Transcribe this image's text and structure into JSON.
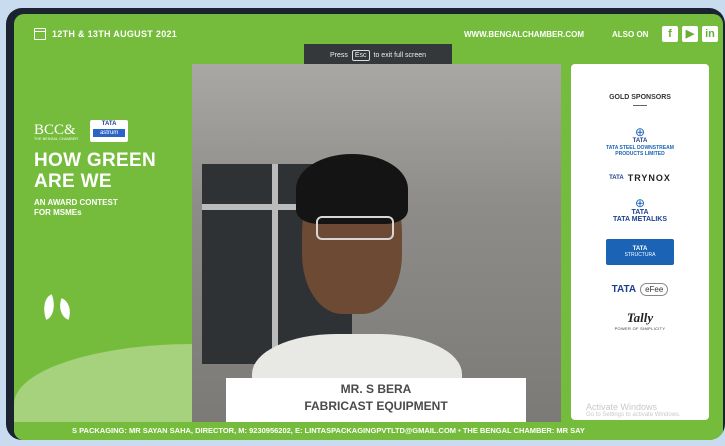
{
  "header": {
    "date": "12TH & 13TH AUGUST 2021",
    "website": "WWW.BENGALCHAMBER.COM",
    "also_on": "ALSO ON",
    "social": [
      "f",
      "▶",
      "in"
    ]
  },
  "fullscreen_hint": {
    "prefix": "Press",
    "key": "Esc",
    "suffix": "to exit full screen"
  },
  "event": {
    "logo_bcc": "BCC&",
    "logo_bcc_sub": "THE BENGAL CHAMBER",
    "logo_tata": "TATA",
    "logo_astrum": "astrum",
    "title_line1": "HOW GREEN",
    "title_line2": "ARE WE",
    "subtitle_line1": "AN AWARD CONTEST",
    "subtitle_line2": "FOR MSMEs"
  },
  "speaker": {
    "name": "MR. S BERA",
    "company": "FABRICAST EQUIPMENT"
  },
  "sponsors": {
    "heading": "GOLD SPONSORS",
    "items": [
      {
        "mark": "TATA",
        "label": "TATA STEEL DOWNSTREAM PRODUCTS LIMITED"
      },
      {
        "mark": "TATA",
        "label": "TRYNOX"
      },
      {
        "mark": "TATA",
        "label": "TATA METALIKS"
      },
      {
        "mark": "TATA",
        "label": "STRUCTURA"
      },
      {
        "mark": "TATA",
        "label": "eFee"
      },
      {
        "mark": "Tally",
        "label": "POWER OF SIMPLICITY"
      }
    ]
  },
  "ticker": "S PACKAGING: MR SAYAN SAHA, DIRECTOR, M: 9230956202, E: LINTASPACKAGINGPVTLTD@GMAIL.COM  •  THE BENGAL CHAMBER: MR SAY",
  "watermark": {
    "line1": "Activate Windows",
    "line2": "Go to Settings to activate Windows."
  },
  "colors": {
    "brand_green": "#76bc3c",
    "tata_blue": "#1c3f8c"
  }
}
